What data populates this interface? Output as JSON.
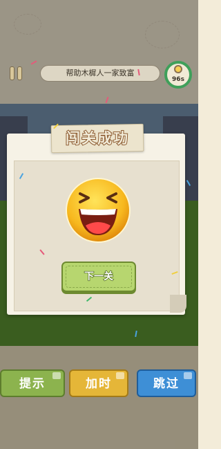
{
  "header": {
    "level_title": "帮助木樨人一家致富",
    "timer": "96s"
  },
  "dialog": {
    "title": "闯关成功",
    "next_label": "下一关"
  },
  "bottom_bar": {
    "hint_label": "提示",
    "add_time_label": "加时",
    "skip_label": "跳过"
  },
  "colors": {
    "hint": "#8cb34e",
    "add_time": "#e5b638",
    "skip": "#3e8fd6",
    "next": "#b7d66f",
    "timer_ring": "#3fa05a"
  },
  "icons": [
    "pause-icon",
    "clock-icon",
    "laughing-emoji-icon",
    "video-ad-icon"
  ]
}
